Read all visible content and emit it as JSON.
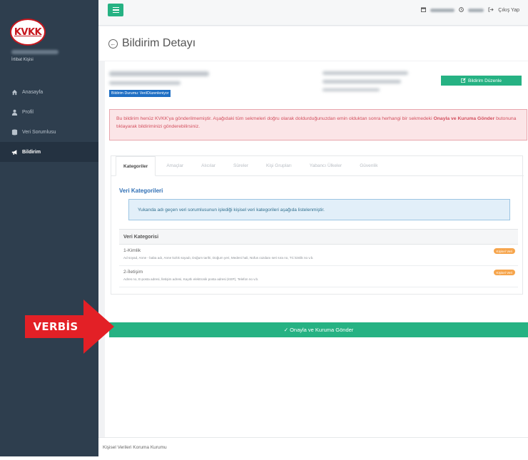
{
  "sidebar": {
    "logo_text": "KVKK",
    "user_role": "İrtibat Kişisi",
    "items": [
      {
        "label": "Anasayfa",
        "icon": "home-icon"
      },
      {
        "label": "Profil",
        "icon": "user-icon"
      },
      {
        "label": "Veri Sorumlusu",
        "icon": "database-icon"
      },
      {
        "label": "Bildirim",
        "icon": "megaphone-icon",
        "active": true
      }
    ]
  },
  "topbar": {
    "logout_label": "Çıkış Yap"
  },
  "page": {
    "title": "Bildirim Detayı"
  },
  "status_badge": "Bildirim Durumu: Veri/Düzenleniyor",
  "edit_button": "Bildirim Düzenle",
  "alert": {
    "text_1": "Bu bildirim henüz KVKK'ya gönderilmemiştir. Aşağıdaki tüm sekmeleri doğru olarak doldurduğunuzdan emin olduktan sonra herhangi bir sekmedeki",
    "bold": "Onayla ve Kuruma Gönder",
    "text_2": " butonuna tıklayarak bildiriminizi gönderebilirsiniz."
  },
  "tabs": [
    "Kategoriler",
    "Amaçlar",
    "Alıcılar",
    "Süreler",
    "Kişi Grupları",
    "Yabancı Ülkeler",
    "Güvenlik"
  ],
  "section_title": "Veri Kategorileri",
  "info_text": "Yukarıda adı geçen veri sorumlusunun işlediği kişisel veri kategorileri aşağıda listelenmiştir.",
  "table": {
    "header": "Veri Kategorisi",
    "rows": [
      {
        "title": "1-Kimlik",
        "desc": "Ad soyad, Anne - baba adı, Anne kızlık soyadı, Doğum tarihi, Doğum yeri, Medeni hali, Nüfus cüzdanı seri sıra no, TC kimlik no v.b.",
        "tag": "Kişisel Veri"
      },
      {
        "title": "2-İletişim",
        "desc": "Adres no, E-posta adresi, İletişim adresi, Kayıtlı elektronik posta adresi (KEP), Telefon no v.b.",
        "tag": "Kişisel Veri"
      }
    ]
  },
  "submit_button": "✓ Onayla ve Kuruma Gönder",
  "footer": "Kişisel Verileri Koruma Kurumu",
  "annotation": "VERBİS",
  "colors": {
    "sidebar": "#2e3e4e",
    "accent_green": "#26b283",
    "alert_red": "#d34f5e",
    "badge_blue": "#1f6fc4",
    "tag_orange": "#f6a54c",
    "arrow_red": "#e32026"
  }
}
